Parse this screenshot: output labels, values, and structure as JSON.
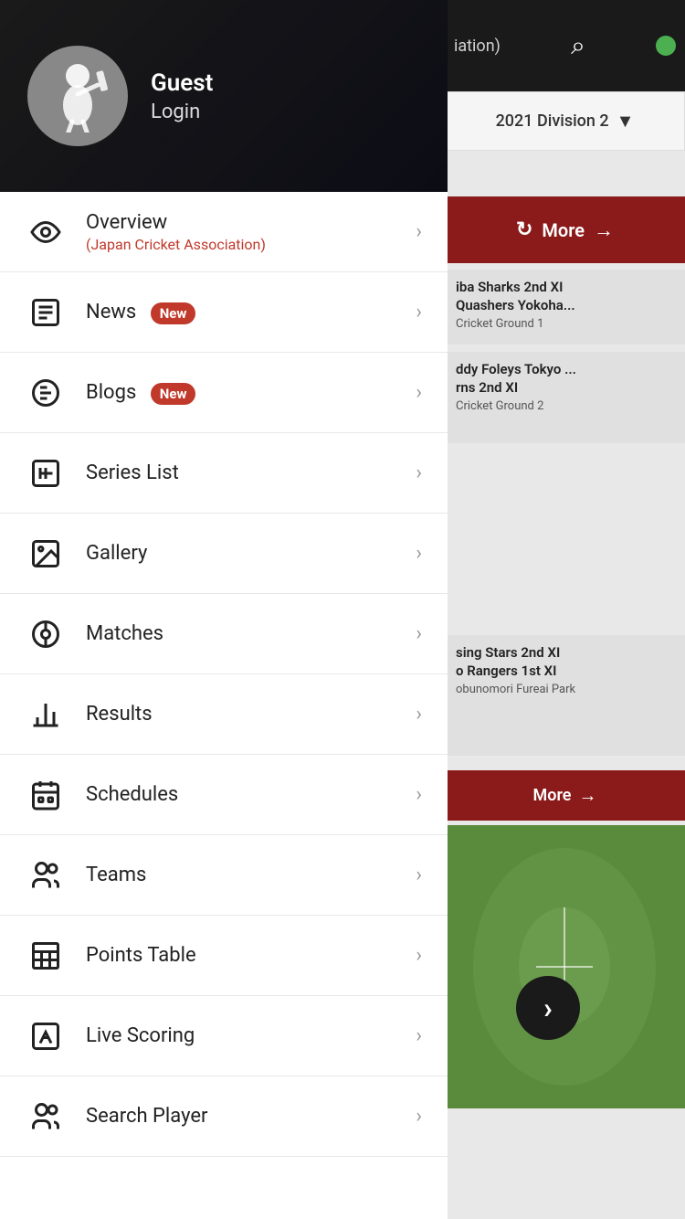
{
  "header": {
    "user_name": "Guest",
    "user_sub": "Login",
    "avatar_alt": "cricket player avatar"
  },
  "right_panel": {
    "dropdown_text": "2021 Division 2",
    "more_label_1": "More",
    "more_label_2": "More",
    "search_icon": "🔍",
    "match_cards": [
      {
        "title": "iba Sharks 2nd XI",
        "title2": "Quashers Yokoha...",
        "subtitle": "Cricket Ground 1"
      },
      {
        "title": "ddy Foleys Tokyo ...",
        "title2": "rns 2nd XI",
        "subtitle": "Cricket Ground 2"
      },
      {
        "title": "sing Stars 2nd XI",
        "title2": "o Rangers 1st XI",
        "subtitle": "obunomori Fureai Park"
      }
    ]
  },
  "menu": {
    "items": [
      {
        "id": "overview",
        "label": "Overview",
        "sublabel": "(Japan Cricket Association)",
        "has_badge": false,
        "badge_text": ""
      },
      {
        "id": "news",
        "label": "News",
        "sublabel": "",
        "has_badge": true,
        "badge_text": "New"
      },
      {
        "id": "blogs",
        "label": "Blogs",
        "sublabel": "",
        "has_badge": true,
        "badge_text": "New"
      },
      {
        "id": "series-list",
        "label": "Series List",
        "sublabel": "",
        "has_badge": false,
        "badge_text": ""
      },
      {
        "id": "gallery",
        "label": "Gallery",
        "sublabel": "",
        "has_badge": false,
        "badge_text": ""
      },
      {
        "id": "matches",
        "label": "Matches",
        "sublabel": "",
        "has_badge": false,
        "badge_text": ""
      },
      {
        "id": "results",
        "label": "Results",
        "sublabel": "",
        "has_badge": false,
        "badge_text": ""
      },
      {
        "id": "schedules",
        "label": "Schedules",
        "sublabel": "",
        "has_badge": false,
        "badge_text": ""
      },
      {
        "id": "teams",
        "label": "Teams",
        "sublabel": "",
        "has_badge": false,
        "badge_text": ""
      },
      {
        "id": "points-table",
        "label": "Points Table",
        "sublabel": "",
        "has_badge": false,
        "badge_text": ""
      },
      {
        "id": "live-scoring",
        "label": "Live Scoring",
        "sublabel": "",
        "has_badge": false,
        "badge_text": ""
      },
      {
        "id": "search-player",
        "label": "Search Player",
        "sublabel": "",
        "has_badge": false,
        "badge_text": ""
      }
    ]
  },
  "next_button_label": "›"
}
